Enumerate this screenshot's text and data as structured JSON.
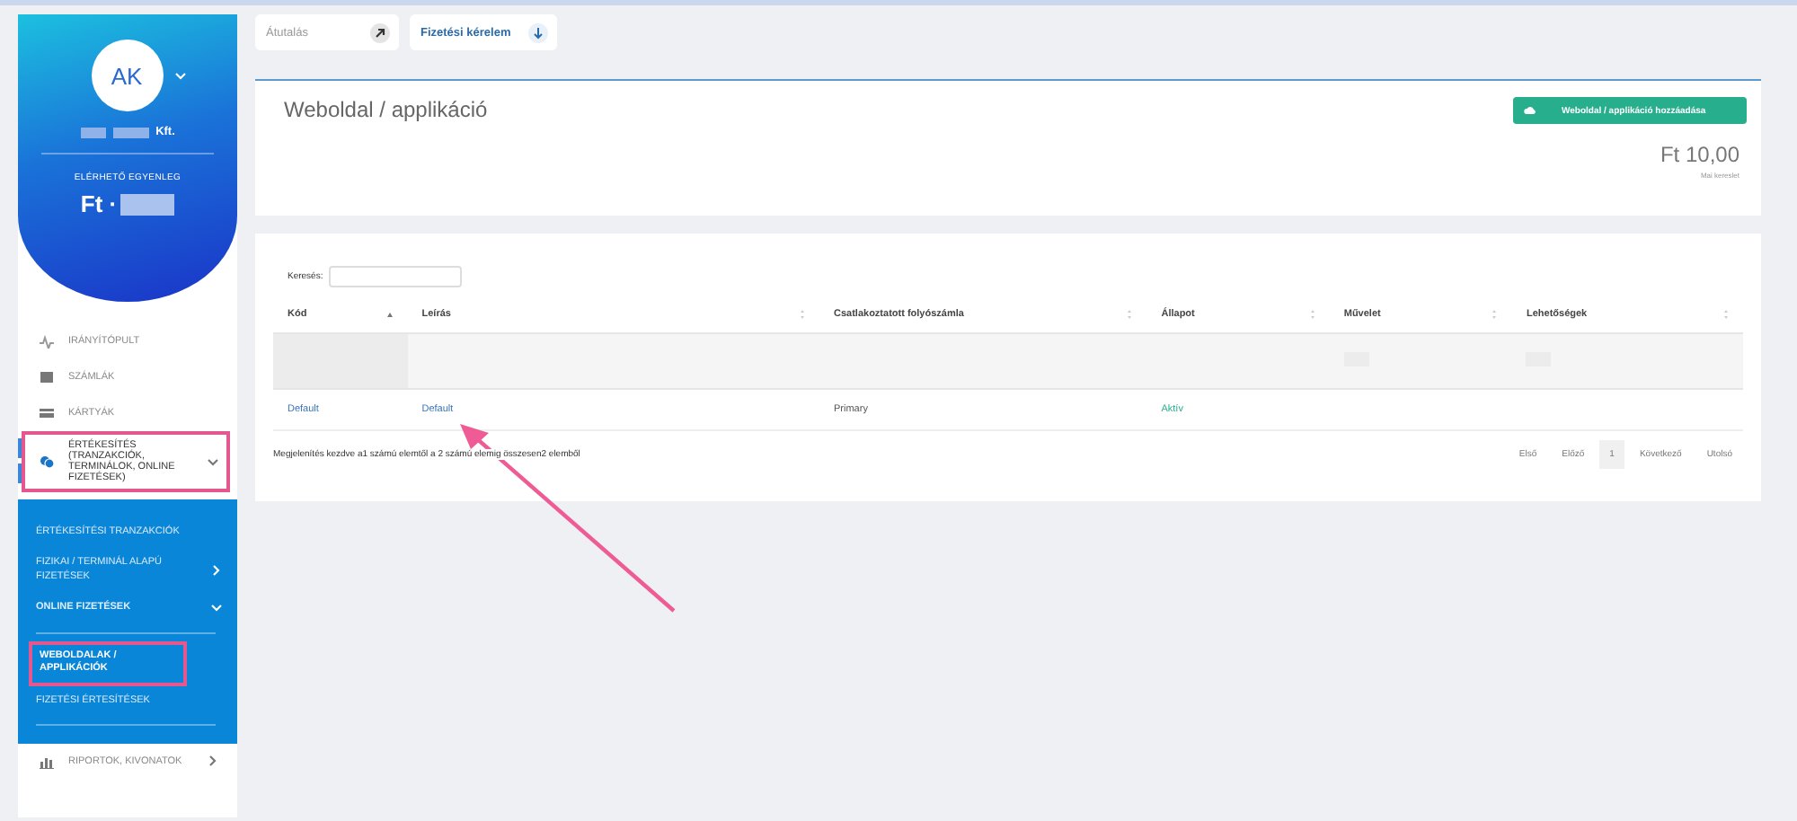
{
  "header_buttons": [
    {
      "label": "Átutalás",
      "kind": "transfer"
    },
    {
      "label": "Fizetési kérelem",
      "kind": "request"
    }
  ],
  "profile": {
    "initials": "AK",
    "company_suffix": "Kft.",
    "balance_label": "ELÉRHETŐ EGYENLEG",
    "balance_prefix": "Ft ·"
  },
  "sidebar": {
    "items": [
      {
        "label": "IRÁNYÍTÓPULT",
        "kind": "pulse",
        "highlighted": false
      },
      {
        "label": "SZÁMLÁK",
        "kind": "wallet",
        "highlighted": false
      },
      {
        "label": "KÁRTYÁK",
        "kind": "card",
        "highlighted": false
      },
      {
        "label": "ÉRTÉKESÍTÉS (TRANZAKCIÓK, TERMINÁLOK, ONLINE FIZETÉSEK)",
        "kind": "coins",
        "highlighted": true,
        "expanded": true,
        "children": [
          {
            "label": "ÉRTÉKESÍTÉSI TRANZAKCIÓK",
            "selected": false,
            "highlighted": false
          },
          {
            "label": "FIZIKAI / TERMINÁL ALAPÚ FIZETÉSEK",
            "selected": false,
            "highlighted": false,
            "expanded": false
          },
          {
            "label": "ONLINE FIZETÉSEK",
            "selected": false,
            "highlighted": false,
            "expanded": true,
            "children": [
              {
                "label": "WEBOLDALAK / APPLIKÁCIÓK",
                "selected": true,
                "highlighted": true
              },
              {
                "label": "FIZETÉSI ÉRTESÍTÉSEK",
                "selected": false,
                "highlighted": false
              }
            ]
          }
        ]
      },
      {
        "label": "RIPORTOK, KIVONATOK",
        "kind": "chart",
        "highlighted": false,
        "expanded": false
      }
    ]
  },
  "page": {
    "title": "Weboldal / applikáció",
    "add_button": "Weboldal / applikáció hozzáadása",
    "amount": "Ft 10,00",
    "amount_caption": "Mai kereslet"
  },
  "table": {
    "search_label": "Keresés:",
    "columns": [
      {
        "label": "Kód",
        "sorted": true
      },
      {
        "label": "Leírás",
        "sorted": false
      },
      {
        "label": "Csatlakoztatott folyószámla",
        "sorted": false
      },
      {
        "label": "Állapot",
        "sorted": false
      },
      {
        "label": "Művelet",
        "sorted": false
      },
      {
        "label": "Lehetőségek",
        "sorted": false
      }
    ],
    "rows": [
      {
        "kind": "blurred",
        "cells": []
      },
      {
        "kind": "data",
        "cells": [
          {
            "text": "Default",
            "kind": "link"
          },
          {
            "text": "Default",
            "kind": "link"
          },
          {
            "text": "Primary",
            "kind": "text"
          },
          {
            "text": "Aktív",
            "kind": "status"
          }
        ]
      }
    ],
    "info": "Megjelenítés kezdve a1 számú elemtől a 2 számú elemig összesen2 elemből",
    "pagination": [
      {
        "label": "Első",
        "selected": false
      },
      {
        "label": "Előző",
        "selected": false
      },
      {
        "label": "1",
        "selected": true
      },
      {
        "label": "Következő",
        "selected": false
      },
      {
        "label": "Utolsó",
        "selected": false
      }
    ]
  }
}
